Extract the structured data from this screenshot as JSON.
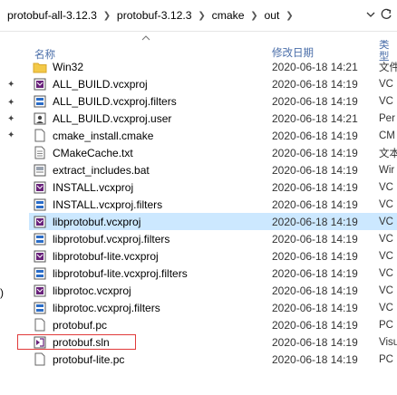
{
  "breadcrumb": [
    "protobuf-all-3.12.3",
    "protobuf-3.12.3",
    "cmake",
    "out"
  ],
  "columns": {
    "name": "名称",
    "date": "修改日期",
    "type": "类型"
  },
  "files": [
    {
      "name": "Win32",
      "date": "2020-06-18 14:21",
      "type": "文件",
      "icon": "folder-icon"
    },
    {
      "name": "ALL_BUILD.vcxproj",
      "date": "2020-06-18 14:19",
      "type": "VC",
      "icon": "vcxproj-icon"
    },
    {
      "name": "ALL_BUILD.vcxproj.filters",
      "date": "2020-06-18 14:19",
      "type": "VC",
      "icon": "filters-icon"
    },
    {
      "name": "ALL_BUILD.vcxproj.user",
      "date": "2020-06-18 14:21",
      "type": "Per",
      "icon": "user-file-icon"
    },
    {
      "name": "cmake_install.cmake",
      "date": "2020-06-18 14:19",
      "type": "CM",
      "icon": "blank-file-icon"
    },
    {
      "name": "CMakeCache.txt",
      "date": "2020-06-18 14:19",
      "type": "文本",
      "icon": "text-file-icon"
    },
    {
      "name": "extract_includes.bat",
      "date": "2020-06-18 14:19",
      "type": "Wir",
      "icon": "batch-file-icon"
    },
    {
      "name": "INSTALL.vcxproj",
      "date": "2020-06-18 14:19",
      "type": "VC",
      "icon": "vcxproj-icon"
    },
    {
      "name": "INSTALL.vcxproj.filters",
      "date": "2020-06-18 14:19",
      "type": "VC",
      "icon": "filters-icon"
    },
    {
      "name": "libprotobuf.vcxproj",
      "date": "2020-06-18 14:19",
      "type": "VC",
      "icon": "vcxproj-icon"
    },
    {
      "name": "libprotobuf.vcxproj.filters",
      "date": "2020-06-18 14:19",
      "type": "VC",
      "icon": "filters-icon"
    },
    {
      "name": "libprotobuf-lite.vcxproj",
      "date": "2020-06-18 14:19",
      "type": "VC",
      "icon": "vcxproj-icon"
    },
    {
      "name": "libprotobuf-lite.vcxproj.filters",
      "date": "2020-06-18 14:19",
      "type": "VC",
      "icon": "filters-icon"
    },
    {
      "name": "libprotoc.vcxproj",
      "date": "2020-06-18 14:19",
      "type": "VC",
      "icon": "vcxproj-icon"
    },
    {
      "name": "libprotoc.vcxproj.filters",
      "date": "2020-06-18 14:19",
      "type": "VC",
      "icon": "filters-icon"
    },
    {
      "name": "protobuf.pc",
      "date": "2020-06-18 14:19",
      "type": "PC",
      "icon": "blank-file-icon"
    },
    {
      "name": "protobuf.sln",
      "date": "2020-06-18 14:19",
      "type": "Visu",
      "icon": "sln-icon"
    },
    {
      "name": "protobuf-lite.pc",
      "date": "2020-06-18 14:19",
      "type": "PC",
      "icon": "blank-file-icon"
    }
  ],
  "selected_row": "libprotobuf.vcxproj",
  "highlighted_row": "protobuf.sln",
  "colors": {
    "selection": "#cce8ff",
    "highlight_border": "#e03a3a",
    "header_text": "#4a6ea9"
  }
}
